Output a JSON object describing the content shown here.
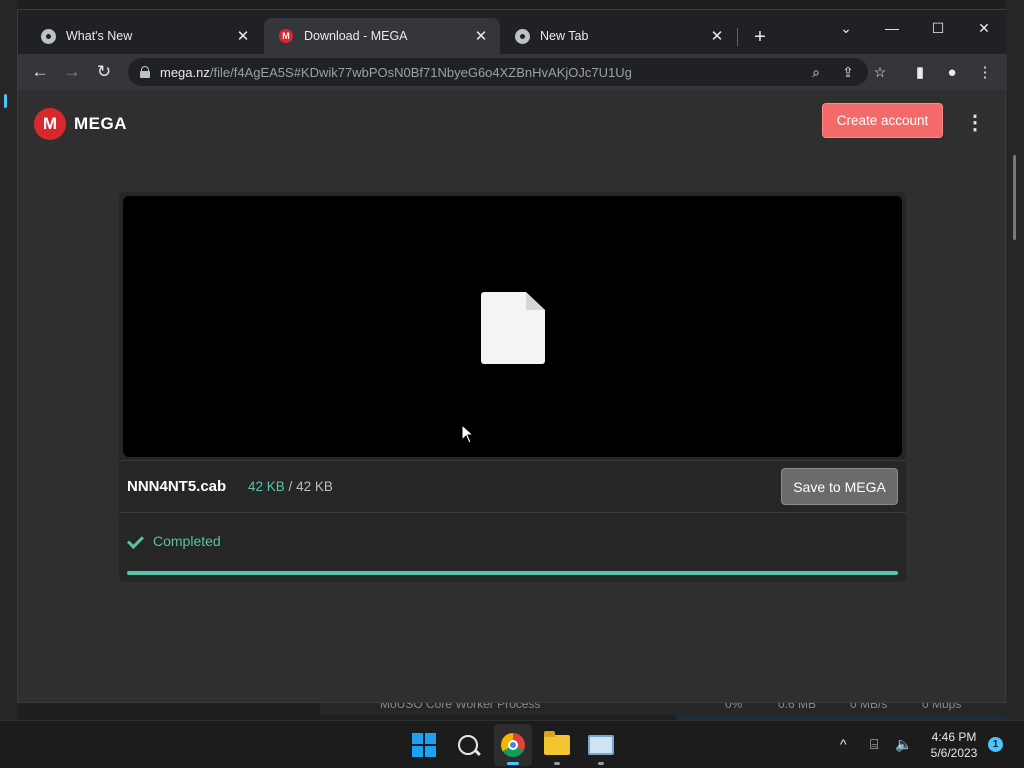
{
  "tabs": [
    {
      "title": "What's New",
      "icon": "chrome-icon"
    },
    {
      "title": "Download - MEGA",
      "icon": "mega-favicon"
    },
    {
      "title": "New Tab",
      "icon": "chrome-icon"
    }
  ],
  "tab_close_glyph": "✕",
  "new_tab_glyph": "+",
  "window_controls": {
    "dropdown": "⌄",
    "minimize": "—",
    "maximize": "☐",
    "close": "✕"
  },
  "toolbar": {
    "back_glyph": "←",
    "forward_glyph": "→",
    "reload_glyph": "↻",
    "url_host": "mega.nz",
    "url_path": "/file/f4AgEA5S#KDwik77wbPOsN0Bf71NbyeG6o4XZBnHvAKjOJc7U1Ug",
    "zoom_glyph": "⌕",
    "share_glyph": "⇪",
    "bookmark_glyph": "☆",
    "sidepanel_glyph": "▮",
    "profile_glyph": "●",
    "menu_glyph": "⋮"
  },
  "page": {
    "logo_letter": "M",
    "logo_text": "MEGA",
    "create_account": "Create account",
    "kebab_glyph": "⋮",
    "file_name": "NNN4NT5.cab",
    "downloaded_size": "42 KB",
    "size_separator": "/",
    "total_size": "42 KB",
    "save_button": "Save to MEGA",
    "status": "Completed",
    "progress_fraction": 1.0,
    "accent_color": "#56c4a8",
    "create_button_color": "#f46a6a"
  },
  "background": {
    "process_name": "MoUSO Core Worker Process",
    "cpu": "0%",
    "memory": "0.6 MB",
    "disk": "0 MB/s",
    "network": "0 Mbps"
  },
  "taskbar": {
    "time": "4:46 PM",
    "date": "5/6/2023",
    "notification_count": "1",
    "chevron_glyph": "^",
    "network_glyph": "⌸",
    "volume_glyph": "🔈"
  }
}
